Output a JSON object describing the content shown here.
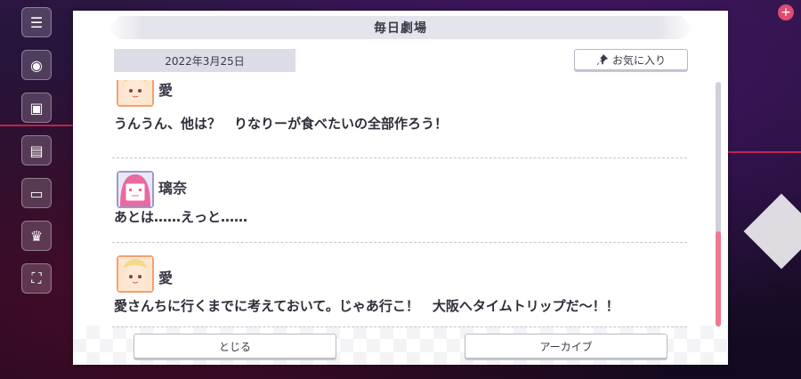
{
  "dialog": {
    "title": "毎日劇場",
    "date": "2022年3月25日",
    "favorite_label": "お気に入り",
    "close_label": "とじる",
    "archive_label": "アーカイブ"
  },
  "entries": [
    {
      "speaker": "愛",
      "avatar_icon": "ai-avatar-icon",
      "text": "うんうん、他は？　りなりーが食べたいの全部作ろう！"
    },
    {
      "speaker": "璃奈",
      "avatar_icon": "rina-avatar-icon",
      "text": "あとは……えっと……"
    },
    {
      "speaker": "愛",
      "avatar_icon": "ai-avatar-icon",
      "text": "愛さんちに行くまでに考えておいて。じゃあ行こ！　大阪へタイムトリップだ～！！"
    }
  ],
  "scroll": {
    "position": 0.9
  },
  "colors": {
    "accent": "#f07890",
    "panel": "#ffffff",
    "band": "#e4e4ec"
  }
}
